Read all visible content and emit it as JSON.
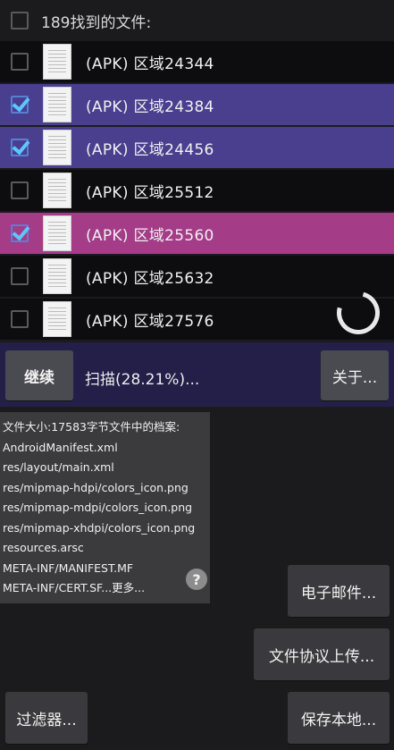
{
  "header": {
    "title": "189找到的文件:"
  },
  "files": [
    {
      "name": "(APK)  区域24344",
      "checked": false
    },
    {
      "name": "(APK)  区域24384",
      "checked": true
    },
    {
      "name": "(APK)  区域24456",
      "checked": true
    },
    {
      "name": "(APK)  区域25512",
      "checked": false
    },
    {
      "name": "(APK)  区域25560",
      "checked": true
    },
    {
      "name": "(APK)  区域25632",
      "checked": false
    },
    {
      "name": "(APK)  区域27576",
      "checked": false
    }
  ],
  "controls": {
    "continue_label": "继续",
    "scan_status": "扫描(28.21%)...",
    "about_label": "关于..."
  },
  "info": {
    "lines": [
      "文件大小:17583字节文件中的档案:",
      "AndroidManifest.xml",
      "res/layout/main.xml",
      "res/mipmap-hdpi/colors_icon.png",
      "res/mipmap-mdpi/colors_icon.png",
      "res/mipmap-xhdpi/colors_icon.png",
      "resources.arsc",
      "META-INF/MANIFEST.MF",
      "META-INF/CERT.SF...更多..."
    ],
    "help_symbol": "?"
  },
  "actions": {
    "email_label": "电子邮件...",
    "ftp_label": "文件协议上传...",
    "filter_label": "过滤器...",
    "save_label": "保存本地..."
  },
  "colors": {
    "background": "#1b1b1d",
    "row_selected_purple": "#4a3f8f",
    "row_selected_pink": "#a43c88",
    "status_bar": "#241f48",
    "check_mark": "#5cc7ff"
  }
}
